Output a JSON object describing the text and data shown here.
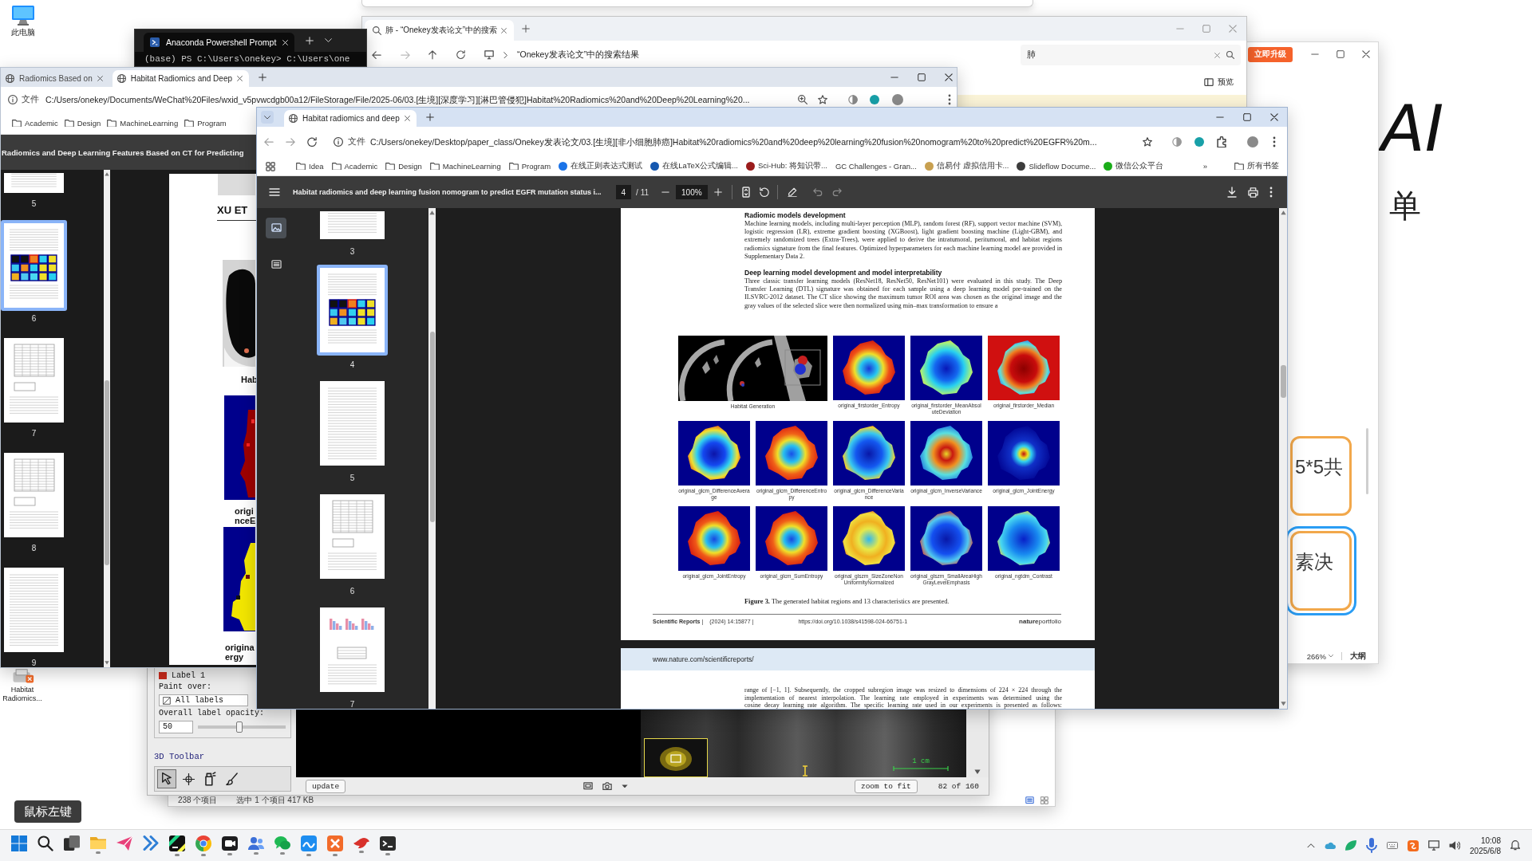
{
  "background_canvas": {
    "heading": "AI",
    "text": "单"
  },
  "desktop": {
    "computer_label": "此电脑",
    "shortcut_label": "Habitat Radiomics..."
  },
  "explorer_window": {
    "tab_title": "肺 - “Onekey发表论文”中的搜索",
    "address": "“Onekey发表论文”中的搜索结果",
    "search_value": "肺",
    "preview_button": "预览"
  },
  "terminal_window": {
    "tab_title": "Anaconda Powershell Prompt",
    "prompt_line": "(base) PS C:\\Users\\onekey> C:\\Users\\one"
  },
  "whiteboard_window": {
    "upgrade_button": "立即升级",
    "nodes": [
      {
        "text": "5*5共",
        "selected": false
      },
      {
        "text": "素决",
        "selected": true
      }
    ],
    "zoom": "266%",
    "outline_button": "大纲"
  },
  "file_explorer_status": {
    "item_count": "238 个项目",
    "selection": "选中 1 个项目 417 KB"
  },
  "segmentation_window": {
    "label": {
      "name": "Label 1",
      "color": "#c62a1c"
    },
    "paint_over_label": "Paint over:",
    "paint_over_value": "All labels",
    "opacity_label": "Overall label opacity:",
    "opacity_value": "50",
    "opacity": {
      "level": 0.47
    },
    "toolbar_title": "3D Toolbar",
    "tools": [
      {
        "selected": true
      },
      {
        "selected": false
      },
      {
        "selected": false
      },
      {
        "selected": false
      }
    ],
    "scale_label": "1 cm",
    "update_button": "update",
    "zoom_button": "zoom to fit",
    "slice_counter": "82 of 160"
  },
  "browser_back": {
    "tabs": [
      {
        "title": "Radiomics Based on",
        "selected": false
      },
      {
        "title": "Habitat Radiomics and Deep",
        "selected": true
      }
    ],
    "url_scheme": "文件",
    "url": "C:/Users/onekey/Documents/WeChat%20Files/wxid_v5pvwcdgb00a12/FileStorage/File/2025-06/03.[生境][深度学习][淋巴管侵犯]Habitat%20Radiomics%20and%20Deep%20Learning%20...",
    "bookmarks": [
      "Academic",
      "Design",
      "MachineLearning",
      "Program"
    ],
    "pdf_title": "Radiomics and Deep Learning Features Based on CT for Predicting",
    "thumbnails": [
      {
        "page": "5",
        "kind": "text",
        "selected": false
      },
      {
        "page": "6",
        "kind": "figure",
        "selected": true
      },
      {
        "page": "7",
        "kind": "table",
        "selected": false
      },
      {
        "page": "8",
        "kind": "table",
        "selected": false
      },
      {
        "page": "9",
        "kind": "text",
        "selected": false
      }
    ],
    "page": {
      "heading": "XU ET",
      "captions": [
        "Hab",
        "origi nceE",
        "origina ergy"
      ]
    }
  },
  "browser_front": {
    "tabs": [
      {
        "title": "Habitat radiomics and deep",
        "selected": true
      }
    ],
    "url_scheme": "文件",
    "url": "C:/Users/onekey/Desktop/paper_class/Onekey发表论文/03.[生境][非小细胞肺癌]Habitat%20radiomics%20and%20deep%20learning%20fusion%20nomogram%20to%20predict%20EGFR%20m...",
    "bookmarks": [
      {
        "label": "Idea",
        "kind": "folder"
      },
      {
        "label": "Academic",
        "kind": "folder"
      },
      {
        "label": "Design",
        "kind": "folder"
      },
      {
        "label": "MachineLearning",
        "kind": "folder"
      },
      {
        "label": "Program",
        "kind": "folder"
      },
      {
        "label": "在线正则表达式测试",
        "kind": "site"
      },
      {
        "label": "在线LaTeX公式编辑...",
        "kind": "site"
      },
      {
        "label": "Sci-Hub: 将知识带...",
        "kind": "site"
      },
      {
        "label": "GC Challenges - Gran...",
        "kind": "text"
      },
      {
        "label": "信易付 虚拟信用卡...",
        "kind": "site"
      },
      {
        "label": "Slideflow Docume...",
        "kind": "site"
      },
      {
        "label": "微信公众平台",
        "kind": "site"
      }
    ],
    "more_bookmarks": "»",
    "all_bookmarks": "所有书签",
    "pdf": {
      "title": "Habitat radiomics and deep learning fusion nomogram to predict EGFR mutation status i...",
      "page_input": "4",
      "page_total": "/ 11",
      "zoom": "100%"
    },
    "sidebar_views": [
      {
        "kind": "thumbnails",
        "selected": true
      },
      {
        "kind": "outline",
        "selected": false
      }
    ],
    "thumbnails": [
      {
        "page": "3",
        "kind": "text",
        "selected": false
      },
      {
        "page": "4",
        "kind": "figure",
        "selected": true
      },
      {
        "page": "5",
        "kind": "text",
        "selected": false
      },
      {
        "page": "6",
        "kind": "table",
        "selected": false
      },
      {
        "page": "7",
        "kind": "chart",
        "selected": false
      }
    ],
    "document": {
      "sections": [
        {
          "heading": "Radiomic models development",
          "body": "Machine learning models, including multi-layer perception (MLP), random forest (RF), support vector machine (SVM), logistic regression (LR), extreme gradient boosting (XGBoost), light gradient boosting machine (Light-GBM), and extremely randomized trees (Extra-Trees), were applied to derive the intratumoral, peritumoral, and habitat regions radiomics signature from the final features. Optimized hyperparameters for each machine learning model are provided in Supplementary Data 2."
        },
        {
          "heading": "Deep learning model development and model interpretability",
          "body": "Three classic transfer learning models (ResNet18, ResNet50, ResNet101) were evaluated in this study. The Deep Transfer Learning (DTL) signature was obtained for each sample using a deep learning model pre-trained on the ILSVRC-2012 dataset. The CT slice showing the maximum tumor ROI area was chosen as the original image and the gray values of the selected slice were then normalized using min–max transformation to ensure a"
        }
      ],
      "figure": {
        "panels": [
          {
            "kind": "ct",
            "caption": "Habitat Generation"
          },
          {
            "kind": "heatmap",
            "caption": "original_firstorder_Entropy"
          },
          {
            "kind": "heatmap",
            "caption": "original_firstorder_MeanAbsoluteDeviation"
          },
          {
            "kind": "heatmap",
            "caption": "original_firstorder_Median"
          },
          {
            "kind": "heatmap",
            "caption": "original_glcm_DifferenceAverage"
          },
          {
            "kind": "heatmap",
            "caption": "original_glcm_DifferenceEntropy"
          },
          {
            "kind": "heatmap",
            "caption": "original_glcm_DifferenceVariance"
          },
          {
            "kind": "heatmap",
            "caption": "original_glcm_InverseVariance"
          },
          {
            "kind": "heatmap",
            "caption": "original_glcm_JointEnergy"
          },
          {
            "kind": "heatmap",
            "caption": "original_glcm_JointEntropy"
          },
          {
            "kind": "heatmap",
            "caption": "original_glcm_SumEntropy"
          },
          {
            "kind": "heatmap",
            "caption": "original_glszm_SizeZoneNonUniformityNormalized"
          },
          {
            "kind": "heatmap",
            "caption": "original_glszm_SmallAreaHighGrayLevelEmphasis"
          },
          {
            "kind": "heatmap",
            "caption": "original_ngtdm_Contrast"
          }
        ],
        "caption": "**Figure 3.** The generated habitat regions and 13 characteristics are presented."
      },
      "footer": {
        "journal": "**Scientific Reports** |",
        "citation": "(2024) 14:15877 |",
        "doi": "https://doi.org/10.1038/s41598-024-66751-1",
        "publisher": "**nature**portfolio"
      },
      "next_page": {
        "header_link": "www.nature.com/scientificreports/",
        "lines": [
          "range of [−1, 1]. Subsequently, the cropped subregion image was resized to dimensions of 224 × 224 through the",
          "implementation of nearest interpolation. The learning rate employed in experiments was determined using the",
          "cosine decay learning rate algorithm. The specific learning rate used in our experiments is presented as follows:"
        ]
      }
    }
  },
  "key_overlay": "鼠标左键",
  "taskbar": {
    "apps": [
      {
        "running": false
      },
      {
        "running": false
      },
      {
        "running": false
      },
      {
        "running": true
      },
      {
        "running": false
      },
      {
        "running": false
      },
      {
        "running": true
      },
      {
        "running": true
      },
      {
        "running": true
      },
      {
        "running": true
      },
      {
        "running": true
      },
      {
        "running": true
      },
      {
        "running": true
      },
      {
        "running": true
      },
      {
        "running": true
      }
    ],
    "clock": {
      "time": "10:08",
      "date": "2025/6/8"
    }
  }
}
